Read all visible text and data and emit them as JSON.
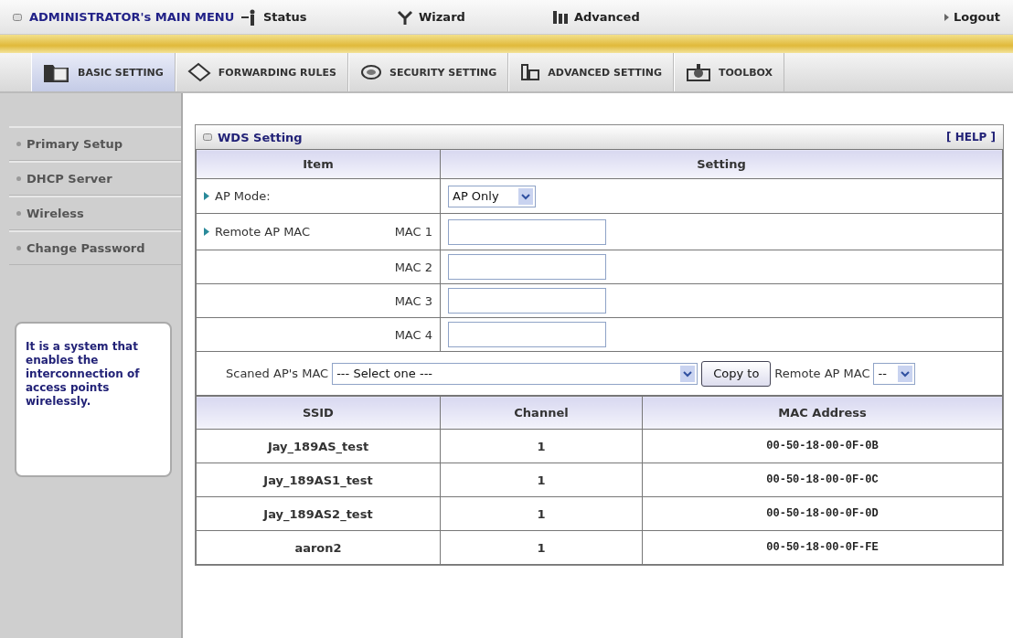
{
  "top_menu": {
    "title": "ADMINISTRATOR's MAIN MENU",
    "items": [
      {
        "label": "Status"
      },
      {
        "label": "Wizard"
      },
      {
        "label": "Advanced"
      }
    ],
    "logout": "Logout"
  },
  "tabs": [
    {
      "label": "BASIC SETTING",
      "selected": true
    },
    {
      "label": "FORWARDING RULES",
      "selected": false
    },
    {
      "label": "SECURITY SETTING",
      "selected": false
    },
    {
      "label": "ADVANCED SETTING",
      "selected": false
    },
    {
      "label": "TOOLBOX",
      "selected": false
    }
  ],
  "sidebar": {
    "items": [
      {
        "label": "Primary Setup"
      },
      {
        "label": "DHCP Server"
      },
      {
        "label": "Wireless"
      },
      {
        "label": "Change Password"
      }
    ],
    "info": "It is a system that enables the interconnection of access points wirelessly."
  },
  "panel": {
    "title": "WDS Setting",
    "help": "[ HELP ]",
    "columns": [
      "Item",
      "Setting"
    ],
    "ap_mode": {
      "label": "AP Mode:",
      "value": "AP Only"
    },
    "remote": {
      "label": "Remote AP MAC",
      "macs": [
        "MAC 1",
        "MAC 2",
        "MAC 3",
        "MAC 4"
      ]
    },
    "scan": {
      "label": "Scaned AP's MAC",
      "select": "--- Select one ---",
      "button": "Copy to",
      "target_label": "Remote AP MAC",
      "target_select": "--"
    }
  },
  "ap_table": {
    "columns": [
      "SSID",
      "Channel",
      "MAC Address"
    ],
    "rows": [
      [
        "Jay_189AS_test",
        "1",
        "00-50-18-00-0F-0B"
      ],
      [
        "Jay_189AS1_test",
        "1",
        "00-50-18-00-0F-0C"
      ],
      [
        "Jay_189AS2_test",
        "1",
        "00-50-18-00-0F-0D"
      ],
      [
        "aaron2",
        "1",
        "00-50-18-00-0F-FE"
      ]
    ]
  }
}
